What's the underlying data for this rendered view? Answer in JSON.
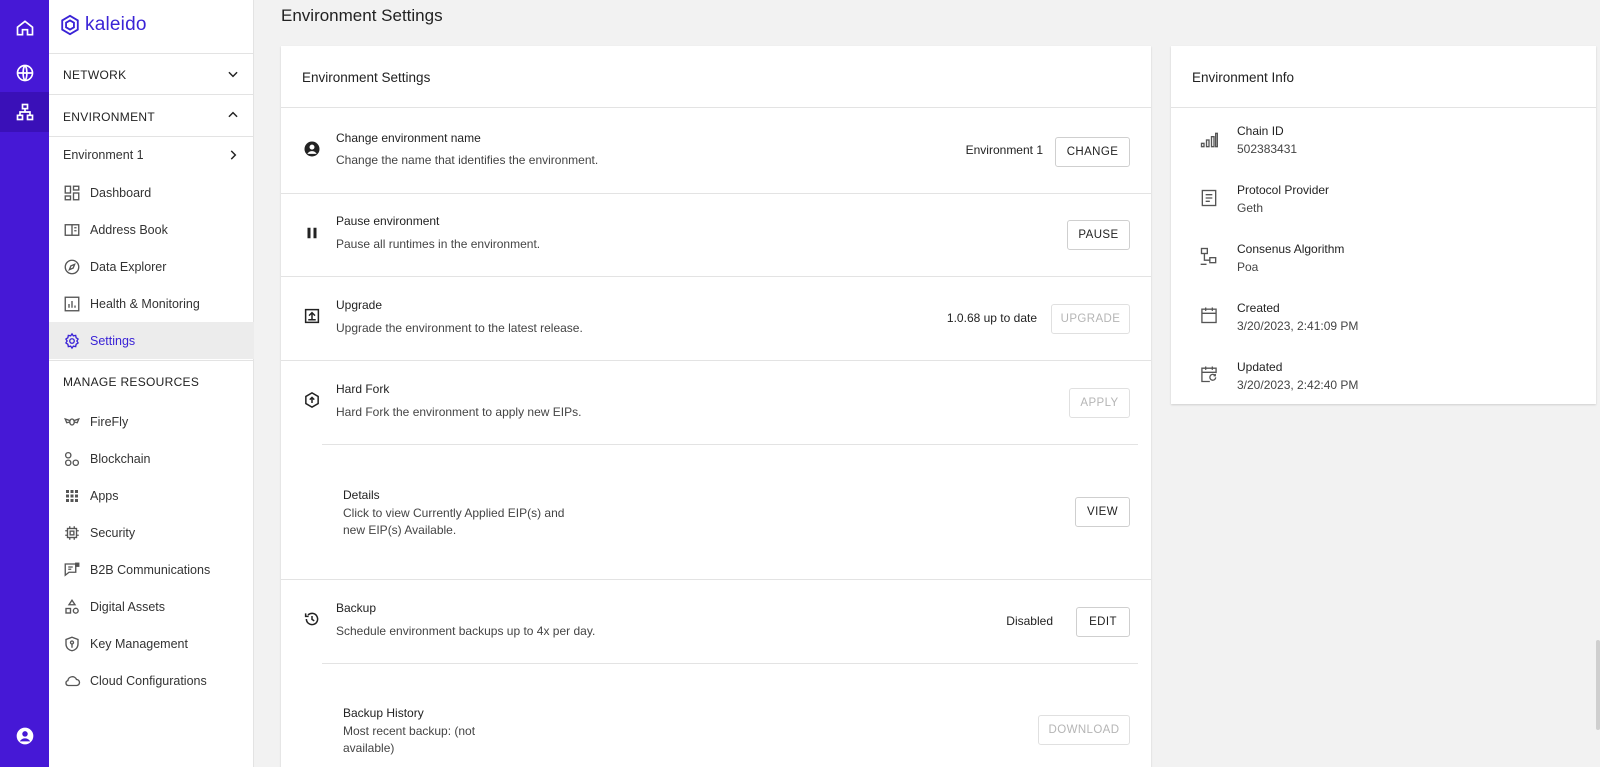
{
  "brand": {
    "name": "kaleido",
    "color": "#4618d6"
  },
  "rail": {
    "items": [
      "home-icon",
      "globe-icon",
      "network-icon",
      "account-icon"
    ]
  },
  "sidebar": {
    "network_label": "NETWORK",
    "environment_label": "ENVIRONMENT",
    "environment_name": "Environment 1",
    "env_items": [
      {
        "label": "Dashboard",
        "icon": "dashboard-icon"
      },
      {
        "label": "Address Book",
        "icon": "address-book-icon"
      },
      {
        "label": "Data Explorer",
        "icon": "compass-icon"
      },
      {
        "label": "Health & Monitoring",
        "icon": "chart-icon"
      },
      {
        "label": "Settings",
        "icon": "gear-icon",
        "active": true
      }
    ],
    "manage_label": "MANAGE RESOURCES",
    "manage_items": [
      {
        "label": "FireFly",
        "icon": "firefly-icon"
      },
      {
        "label": "Blockchain",
        "icon": "blockchain-icon"
      },
      {
        "label": "Apps",
        "icon": "apps-grid-icon"
      },
      {
        "label": "Security",
        "icon": "chip-icon"
      },
      {
        "label": "B2B Communications",
        "icon": "message-icon"
      },
      {
        "label": "Digital Assets",
        "icon": "shapes-icon"
      },
      {
        "label": "Key Management",
        "icon": "shield-key-icon"
      },
      {
        "label": "Cloud Configurations",
        "icon": "cloud-icon"
      }
    ]
  },
  "page": {
    "title": "Environment Settings"
  },
  "settings": {
    "title": "Environment Settings",
    "rows": [
      {
        "title": "Change environment name",
        "desc": "Change the name that identifies the environment.",
        "value": "Environment 1",
        "button": "CHANGE",
        "icon": "account-circle-icon"
      },
      {
        "title": "Pause environment",
        "desc": "Pause all runtimes in the environment.",
        "value": "",
        "button": "PAUSE",
        "icon": "pause-icon"
      },
      {
        "title": "Upgrade",
        "desc": "Upgrade the environment to the latest release.",
        "value": "1.0.68 up to date",
        "button": "UPGRADE",
        "icon": "upgrade-icon"
      },
      {
        "title": "Hard Fork",
        "desc": "Hard Fork the environment to apply new EIPs.",
        "value": "",
        "button": "APPLY",
        "icon": "hard-fork-icon"
      },
      {
        "title": "Details",
        "desc_line1": "Click to view Currently Applied EIP(s) and",
        "desc_line2": "new EIP(s) Available.",
        "button": "VIEW"
      },
      {
        "title": "Backup",
        "desc": "Schedule environment backups up to 4x per day.",
        "value": "Disabled",
        "button": "EDIT",
        "icon": "restore-icon"
      },
      {
        "title": "Backup History",
        "desc_line1": "Most recent backup: (not",
        "desc_line2": "available)",
        "button": "DOWNLOAD"
      }
    ]
  },
  "info": {
    "title": "Environment Info",
    "items": [
      {
        "label": "Chain ID",
        "value": "502383431",
        "icon": "signal-bars-icon"
      },
      {
        "label": "Protocol Provider",
        "value": "Geth",
        "icon": "document-icon"
      },
      {
        "label": "Consenus Algorithm",
        "value": "Poa",
        "icon": "nodes-icon"
      },
      {
        "label": "Created",
        "value": "3/20/2023, 2:41:09 PM",
        "icon": "calendar-icon"
      },
      {
        "label": "Updated",
        "value": "3/20/2023, 2:42:40 PM",
        "icon": "calendar-refresh-icon"
      }
    ]
  }
}
